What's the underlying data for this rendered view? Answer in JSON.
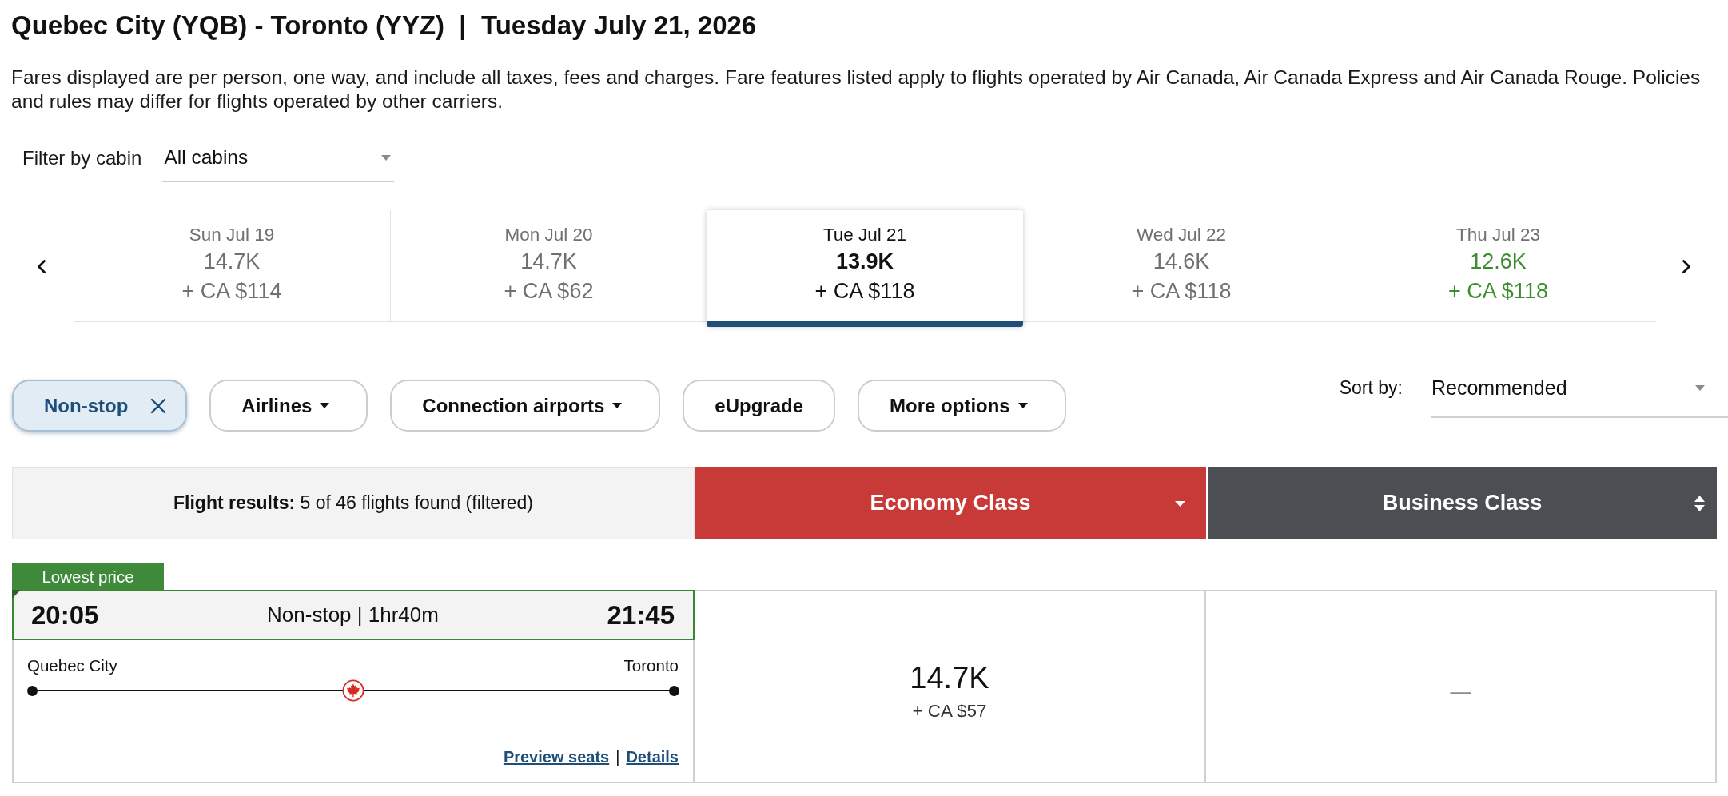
{
  "header": {
    "title": "Quebec City (YQB) - Toronto (YYZ)  |  Tuesday July 21, 2026",
    "notice": "Fares displayed are per person, one way, and include all taxes, fees and charges. Fare features listed apply to flights operated by Air Canada, Air Canada Express and Air Canada Rouge. Policies and rules may differ for flights operated by other carriers."
  },
  "cabin_filter": {
    "label": "Filter by cabin",
    "value": "All cabins"
  },
  "date_carousel": {
    "days": [
      {
        "date": "Sun Jul 19",
        "points": "14.7K",
        "cash": "+ CA $114",
        "selected": false,
        "lowest": false
      },
      {
        "date": "Mon Jul 20",
        "points": "14.7K",
        "cash": "+ CA $62",
        "selected": false,
        "lowest": false
      },
      {
        "date": "Tue Jul 21",
        "points": "13.9K",
        "cash": "+ CA $118",
        "selected": true,
        "lowest": false
      },
      {
        "date": "Wed Jul 22",
        "points": "14.6K",
        "cash": "+ CA $118",
        "selected": false,
        "lowest": false
      },
      {
        "date": "Thu Jul 23",
        "points": "12.6K",
        "cash": "+ CA $118",
        "selected": false,
        "lowest": true
      }
    ]
  },
  "filters": [
    {
      "label": "Non-stop",
      "kind": "toggle",
      "active": true
    },
    {
      "label": "Airlines",
      "kind": "menu",
      "active": false
    },
    {
      "label": "Connection airports",
      "kind": "menu",
      "active": false
    },
    {
      "label": "eUpgrade",
      "kind": "toggle",
      "active": false
    },
    {
      "label": "More options",
      "kind": "menu",
      "active": false
    }
  ],
  "sort": {
    "label": "Sort by:",
    "value": "Recommended"
  },
  "results": {
    "summary": "**Flight results:** 5 of 46 flights found (filtered)",
    "cabins": [
      {
        "label": "Economy Class",
        "color": "#c83a37",
        "sorted": true
      },
      {
        "label": "Business Class",
        "color": "#4b4f54",
        "sorted": false
      }
    ]
  },
  "flights": [
    {
      "badge": "Lowest price",
      "departure": "20:05",
      "summary": "Non-stop | 1hr40m",
      "arrival": "21:45",
      "origin": "Quebec City",
      "destination": "Toronto",
      "links": [
        "Preview seats",
        "Details"
      ],
      "link_separator": "|",
      "fares": [
        {
          "kind": "price",
          "points": "14.7K",
          "cash": "+ CA $57"
        },
        {
          "kind": "unavailable",
          "text": "—"
        }
      ]
    }
  ]
}
